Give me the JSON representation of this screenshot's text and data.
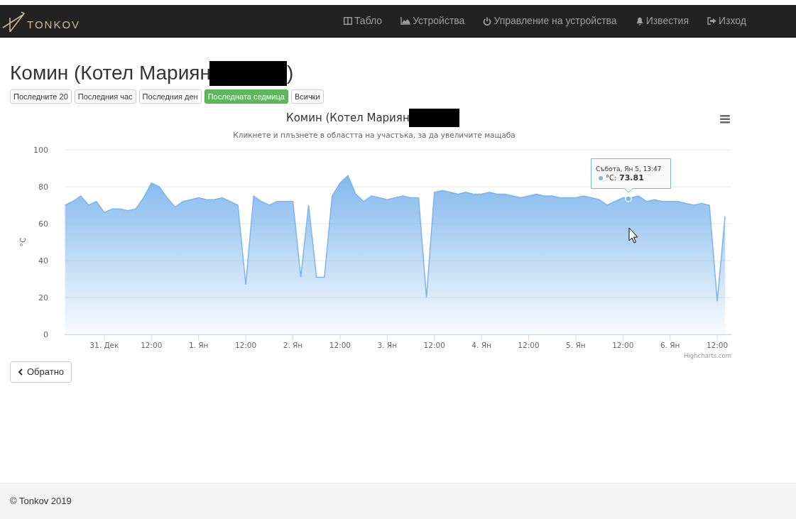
{
  "navbar": {
    "brand": "TONKOV",
    "items": [
      {
        "kind": "dashboard",
        "label": "Табло"
      },
      {
        "kind": "devices",
        "label": "Устройства"
      },
      {
        "kind": "power",
        "label": "Управление на устройства"
      },
      {
        "kind": "bell",
        "label": "Известия"
      },
      {
        "kind": "logout",
        "label": "Изход"
      }
    ]
  },
  "heading": {
    "text": "Комин (Котел Мариян",
    "after": ")",
    "redacted": true
  },
  "ranges": [
    {
      "label": "Последните 20",
      "selected": false
    },
    {
      "label": "Последния час",
      "selected": false
    },
    {
      "label": "Последния ден",
      "selected": false
    },
    {
      "label": "Последната седмица",
      "selected": true
    },
    {
      "label": "Всички",
      "selected": false
    }
  ],
  "chart": {
    "subtitle": "Кликнете и плъзнете в областта на участъка, за да увеличите мащаба",
    "credit": "Highcharts.com",
    "tooltip": {
      "title": "Събота, Ян 5, 13:47",
      "label": "°C:",
      "value": "73.81",
      "color": "#7cb5ec"
    },
    "chart_data": {
      "type": "area",
      "title": "Комин (Котел Мариян",
      "ylabel": "°C",
      "ylim": [
        0,
        100
      ],
      "yticks": [
        0,
        20,
        40,
        60,
        80,
        100
      ],
      "grid": true,
      "categories": [
        null,
        null,
        null,
        null,
        null,
        "31. Дек",
        null,
        null,
        null,
        null,
        null,
        "12:00",
        null,
        null,
        null,
        null,
        null,
        "1. Ян",
        null,
        null,
        null,
        null,
        null,
        "12:00",
        null,
        null,
        null,
        null,
        null,
        "2. Ян",
        null,
        null,
        null,
        null,
        null,
        "12:00",
        null,
        null,
        null,
        null,
        null,
        "3. Ян",
        null,
        null,
        null,
        null,
        null,
        "12:00",
        null,
        null,
        null,
        null,
        null,
        "4. Ян",
        null,
        null,
        null,
        null,
        null,
        "12:00",
        null,
        null,
        null,
        null,
        null,
        "5. Ян",
        null,
        null,
        null,
        null,
        null,
        "12:00",
        null,
        null,
        null,
        null,
        null,
        "6. Ян",
        null,
        null,
        null,
        null,
        null,
        "12:00",
        null
      ],
      "series": [
        {
          "color": "#7cb5ec",
          "values": [
            70,
            72,
            75,
            70,
            72,
            66,
            68,
            68,
            67,
            68,
            74,
            82,
            80,
            74,
            69,
            72,
            73,
            74,
            73,
            73,
            74,
            72,
            70,
            27,
            75,
            72,
            70,
            72,
            72,
            72,
            31,
            70,
            31,
            31,
            75,
            82,
            86,
            76,
            72,
            75,
            74,
            73,
            74,
            75,
            74,
            74,
            20,
            77,
            78,
            77,
            76,
            77,
            76,
            76,
            77,
            76,
            76,
            75,
            74,
            75,
            76,
            75,
            75,
            74,
            74,
            74,
            75,
            74,
            73,
            70,
            72,
            74,
            74,
            75,
            72,
            73,
            72,
            72,
            72,
            71,
            70,
            71,
            70,
            18,
            64
          ]
        }
      ]
    }
  },
  "back_button": "Обратно",
  "footer": "© Tonkov 2019"
}
